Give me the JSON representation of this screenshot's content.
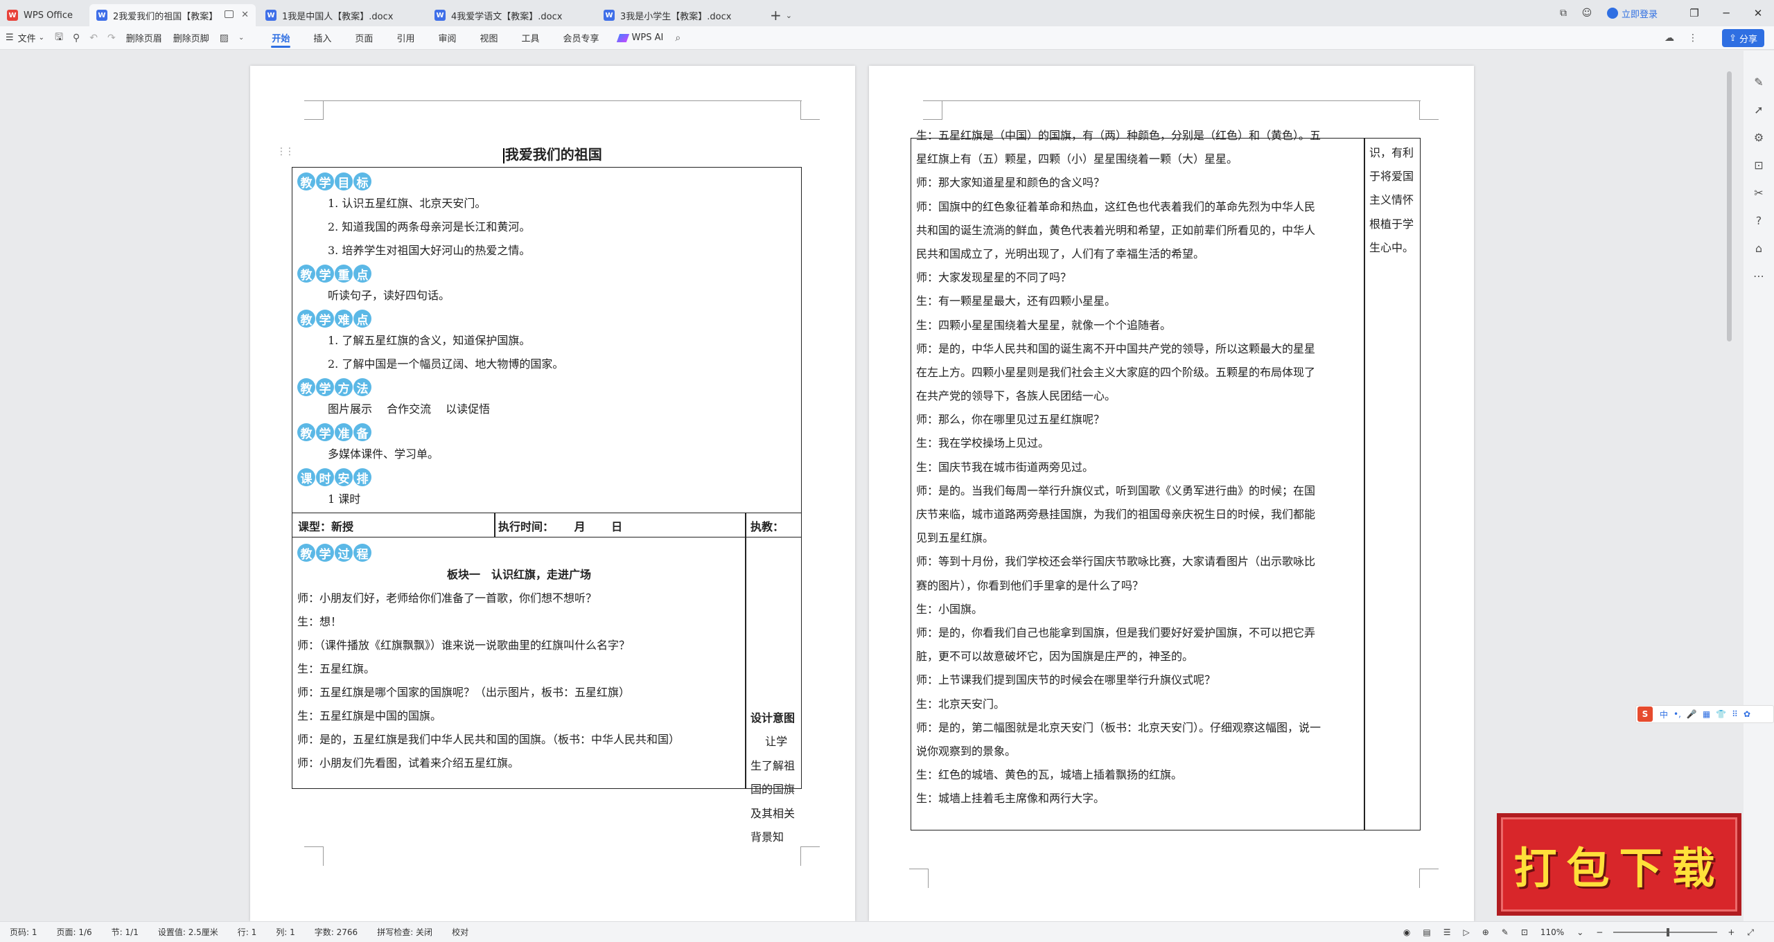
{
  "tabs": {
    "home": "WPS Office",
    "docs": [
      "2我爱我们的祖国【教案】.docx",
      "1我是中国人【教案】.docx",
      "4我爱学语文【教案】.docx",
      "3我是小学生【教案】.docx"
    ],
    "login": "立即登录"
  },
  "ribbon": {
    "file": "文件",
    "del_header": "删除页眉",
    "del_footer": "删除页脚",
    "menus": [
      "开始",
      "插入",
      "页面",
      "引用",
      "审阅",
      "视图",
      "工具",
      "会员专享"
    ],
    "ai": "WPS AI",
    "share": "分享"
  },
  "page1": {
    "title": "我爱我们的祖国",
    "sections": [
      {
        "badge": [
          "教",
          "学",
          "目",
          "标"
        ],
        "lines": [
          "1. 认识五星红旗、北京天安门。",
          "2. 知道我国的两条母亲河是长江和黄河。",
          "3. 培养学生对祖国大好河山的热爱之情。"
        ]
      },
      {
        "badge": [
          "教",
          "学",
          "重",
          "点"
        ],
        "lines": [
          "听读句子，读好四句话。"
        ]
      },
      {
        "badge": [
          "教",
          "学",
          "难",
          "点"
        ],
        "lines": [
          "1. 了解五星红旗的含义，知道保护国旗。",
          "2. 了解中国是一个幅员辽阔、地大物博的国家。"
        ]
      },
      {
        "badge": [
          "教",
          "学",
          "方",
          "法"
        ],
        "lines": [
          "图片展示　 合作交流　 以读促悟"
        ]
      },
      {
        "badge": [
          "教",
          "学",
          "准",
          "备"
        ],
        "lines": [
          "多媒体课件、学习单。"
        ]
      },
      {
        "badge": [
          "课",
          "时",
          "安",
          "排"
        ],
        "lines": [
          "1 课时"
        ]
      }
    ],
    "meta": {
      "type": "课型：新授",
      "time": "执行时间：　　 月　　 日",
      "teacher": "执教："
    },
    "process_badge": [
      "教",
      "学",
      "过",
      "程"
    ],
    "block_title": "板块一　认识红旗，走进广场",
    "process_lines": [
      "师：小朋友们好，老师给你们准备了一首歌，你们想不想听？",
      "生：想！",
      "师：（课件播放《红旗飘飘》）谁来说一说歌曲里的红旗叫什么名字？",
      "生：五星红旗。",
      "师：五星红旗是哪个国家的国旗呢？（出示图片，板书：五星红旗）",
      "生：五星红旗是中国的国旗。",
      "师：是的，五星红旗是我们中华人民共和国的国旗。（板书：中华人民共和国）",
      "师：小朋友们先看图，试着来介绍五星红旗。"
    ],
    "design_title": "设计意图",
    "design_lines": [
      "　 让学",
      "生了解祖",
      "国的国旗",
      "及其相关",
      "背景知"
    ]
  },
  "page2": {
    "lines": [
      "生：五星红旗是（中国）的国旗，有（两）种颜色，分别是（红色）和（黄色）。五",
      "星红旗上有（五）颗星，四颗（小）星星围绕着一颗（大）星星。",
      "师：那大家知道星星和颜色的含义吗？",
      "师：国旗中的红色象征着革命和热血，这红色也代表着我们的革命先烈为中华人民",
      "共和国的诞生流淌的鲜血，黄色代表着光明和希望，正如前辈们所看见的，中华人",
      "民共和国成立了，光明出现了，人们有了幸福生活的希望。",
      "师：大家发现星星的不同了吗？",
      "生：有一颗星星最大，还有四颗小星星。",
      "生：四颗小星星围绕着大星星，就像一个个追随者。",
      "师：是的，中华人民共和国的诞生离不开中国共产党的领导，所以这颗最大的星星",
      "在左上方。四颗小星星则是我们社会主义大家庭的四个阶级。五颗星的布局体现了",
      "在共产党的领导下，各族人民团结一心。",
      "师：那么，你在哪里见过五星红旗呢？",
      "生：我在学校操场上见过。",
      "生：国庆节我在城市街道两旁见过。",
      "师：是的。当我们每周一举行升旗仪式，听到国歌《义勇军进行曲》的时候；在国",
      "庆节来临，城市道路两旁悬挂国旗，为我们的祖国母亲庆祝生日的时候，我们都能",
      "见到五星红旗。",
      "师：等到十月份，我们学校还会举行国庆节歌咏比赛，大家请看图片（出示歌咏比",
      "赛的图片），你看到他们手里拿的是什么了吗？",
      "生：小国旗。",
      "师：是的，你看我们自己也能拿到国旗，但是我们要好好爱护国旗，不可以把它弄",
      "脏，更不可以故意破坏它，因为国旗是庄严的，神圣的。",
      "师：上节课我们提到国庆节的时候会在哪里举行升旗仪式呢？",
      "生：北京天安门。",
      "师：是的，第二幅图就是北京天安门（板书：北京天安门）。仔细观察这幅图，说一",
      "说你观察到的景象。",
      "生：红色的城墙、黄色的瓦，城墙上插着飘扬的红旗。",
      "生：城墙上挂着毛主席像和两行大字。"
    ],
    "side_lines": [
      "识，有利",
      "于将爱国",
      "主义情怀",
      "根植于学",
      "生心中。"
    ]
  },
  "ime": {
    "logo": "S",
    "items": [
      "中",
      "•,",
      "🎤",
      "▦",
      "👕",
      "⠿",
      "✿"
    ]
  },
  "status": {
    "page": "页码: 1",
    "pages": "页面: 1/6",
    "section": "节: 1/1",
    "setting": "设置值: 2.5厘米",
    "row": "行: 1",
    "col": "列: 1",
    "words": "字数: 2766",
    "spell": "拼写检查: 关闭",
    "proof": "校对",
    "zoom": "110%"
  },
  "banner": "打包下载",
  "zoom_level": 1.1
}
